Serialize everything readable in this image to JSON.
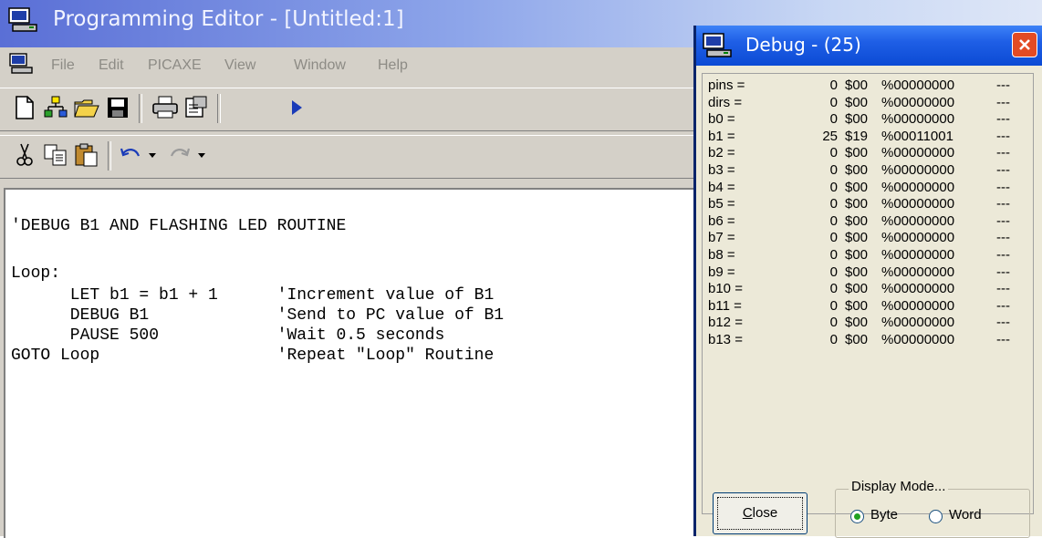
{
  "main_window": {
    "title": "Programming Editor  - [Untitled:1]",
    "menu": [
      "File",
      "Edit",
      "PICAXE",
      "View",
      "Window",
      "Help"
    ]
  },
  "toolbar1": {
    "icons": [
      "new-file-icon",
      "program-icon",
      "open-folder-icon",
      "save-icon",
      "print-icon",
      "options-icon",
      "run-icon"
    ]
  },
  "toolbar2": {
    "icons": [
      "cut-icon",
      "copy-icon",
      "paste-icon",
      "undo-icon",
      "undo-dropdown-icon",
      "redo-icon",
      "redo-dropdown-icon"
    ]
  },
  "editor": {
    "lines": [
      "'DEBUG B1 AND FLASHING LED ROUTINE",
      "Loop:",
      "      LET b1 = b1 + 1      'Increment value of B1",
      "      DEBUG B1             'Send to PC value of B1",
      "      PAUSE 500            'Wait 0.5 seconds",
      "GOTO Loop                  'Repeat \"Loop\" Routine"
    ]
  },
  "debug_window": {
    "title": "Debug - (25)",
    "registers": [
      {
        "name": "pins =",
        "dec": "0",
        "hex": "$00",
        "bin": "%00000000",
        "ascii": "---"
      },
      {
        "name": "dirs =",
        "dec": "0",
        "hex": "$00",
        "bin": "%00000000",
        "ascii": "---"
      },
      {
        "name": "b0  =",
        "dec": "0",
        "hex": "$00",
        "bin": "%00000000",
        "ascii": "---"
      },
      {
        "name": "b1  =",
        "dec": "25",
        "hex": "$19",
        "bin": "%00011001",
        "ascii": "---"
      },
      {
        "name": "b2  =",
        "dec": "0",
        "hex": "$00",
        "bin": "%00000000",
        "ascii": "---"
      },
      {
        "name": "b3  =",
        "dec": "0",
        "hex": "$00",
        "bin": "%00000000",
        "ascii": "---"
      },
      {
        "name": "b4  =",
        "dec": "0",
        "hex": "$00",
        "bin": "%00000000",
        "ascii": "---"
      },
      {
        "name": "b5  =",
        "dec": "0",
        "hex": "$00",
        "bin": "%00000000",
        "ascii": "---"
      },
      {
        "name": "b6  =",
        "dec": "0",
        "hex": "$00",
        "bin": "%00000000",
        "ascii": "---"
      },
      {
        "name": "b7  =",
        "dec": "0",
        "hex": "$00",
        "bin": "%00000000",
        "ascii": "---"
      },
      {
        "name": "b8  =",
        "dec": "0",
        "hex": "$00",
        "bin": "%00000000",
        "ascii": "---"
      },
      {
        "name": "b9  =",
        "dec": "0",
        "hex": "$00",
        "bin": "%00000000",
        "ascii": "---"
      },
      {
        "name": "b10 =",
        "dec": "0",
        "hex": "$00",
        "bin": "%00000000",
        "ascii": "---"
      },
      {
        "name": "b11 =",
        "dec": "0",
        "hex": "$00",
        "bin": "%00000000",
        "ascii": "---"
      },
      {
        "name": "b12 =",
        "dec": "0",
        "hex": "$00",
        "bin": "%00000000",
        "ascii": "---"
      },
      {
        "name": "b13 =",
        "dec": "0",
        "hex": "$00",
        "bin": "%00000000",
        "ascii": "---"
      }
    ],
    "close_label": "Close",
    "display_mode": {
      "legend": "Display Mode...",
      "options": [
        "Byte",
        "Word"
      ],
      "selected": "Byte"
    }
  }
}
